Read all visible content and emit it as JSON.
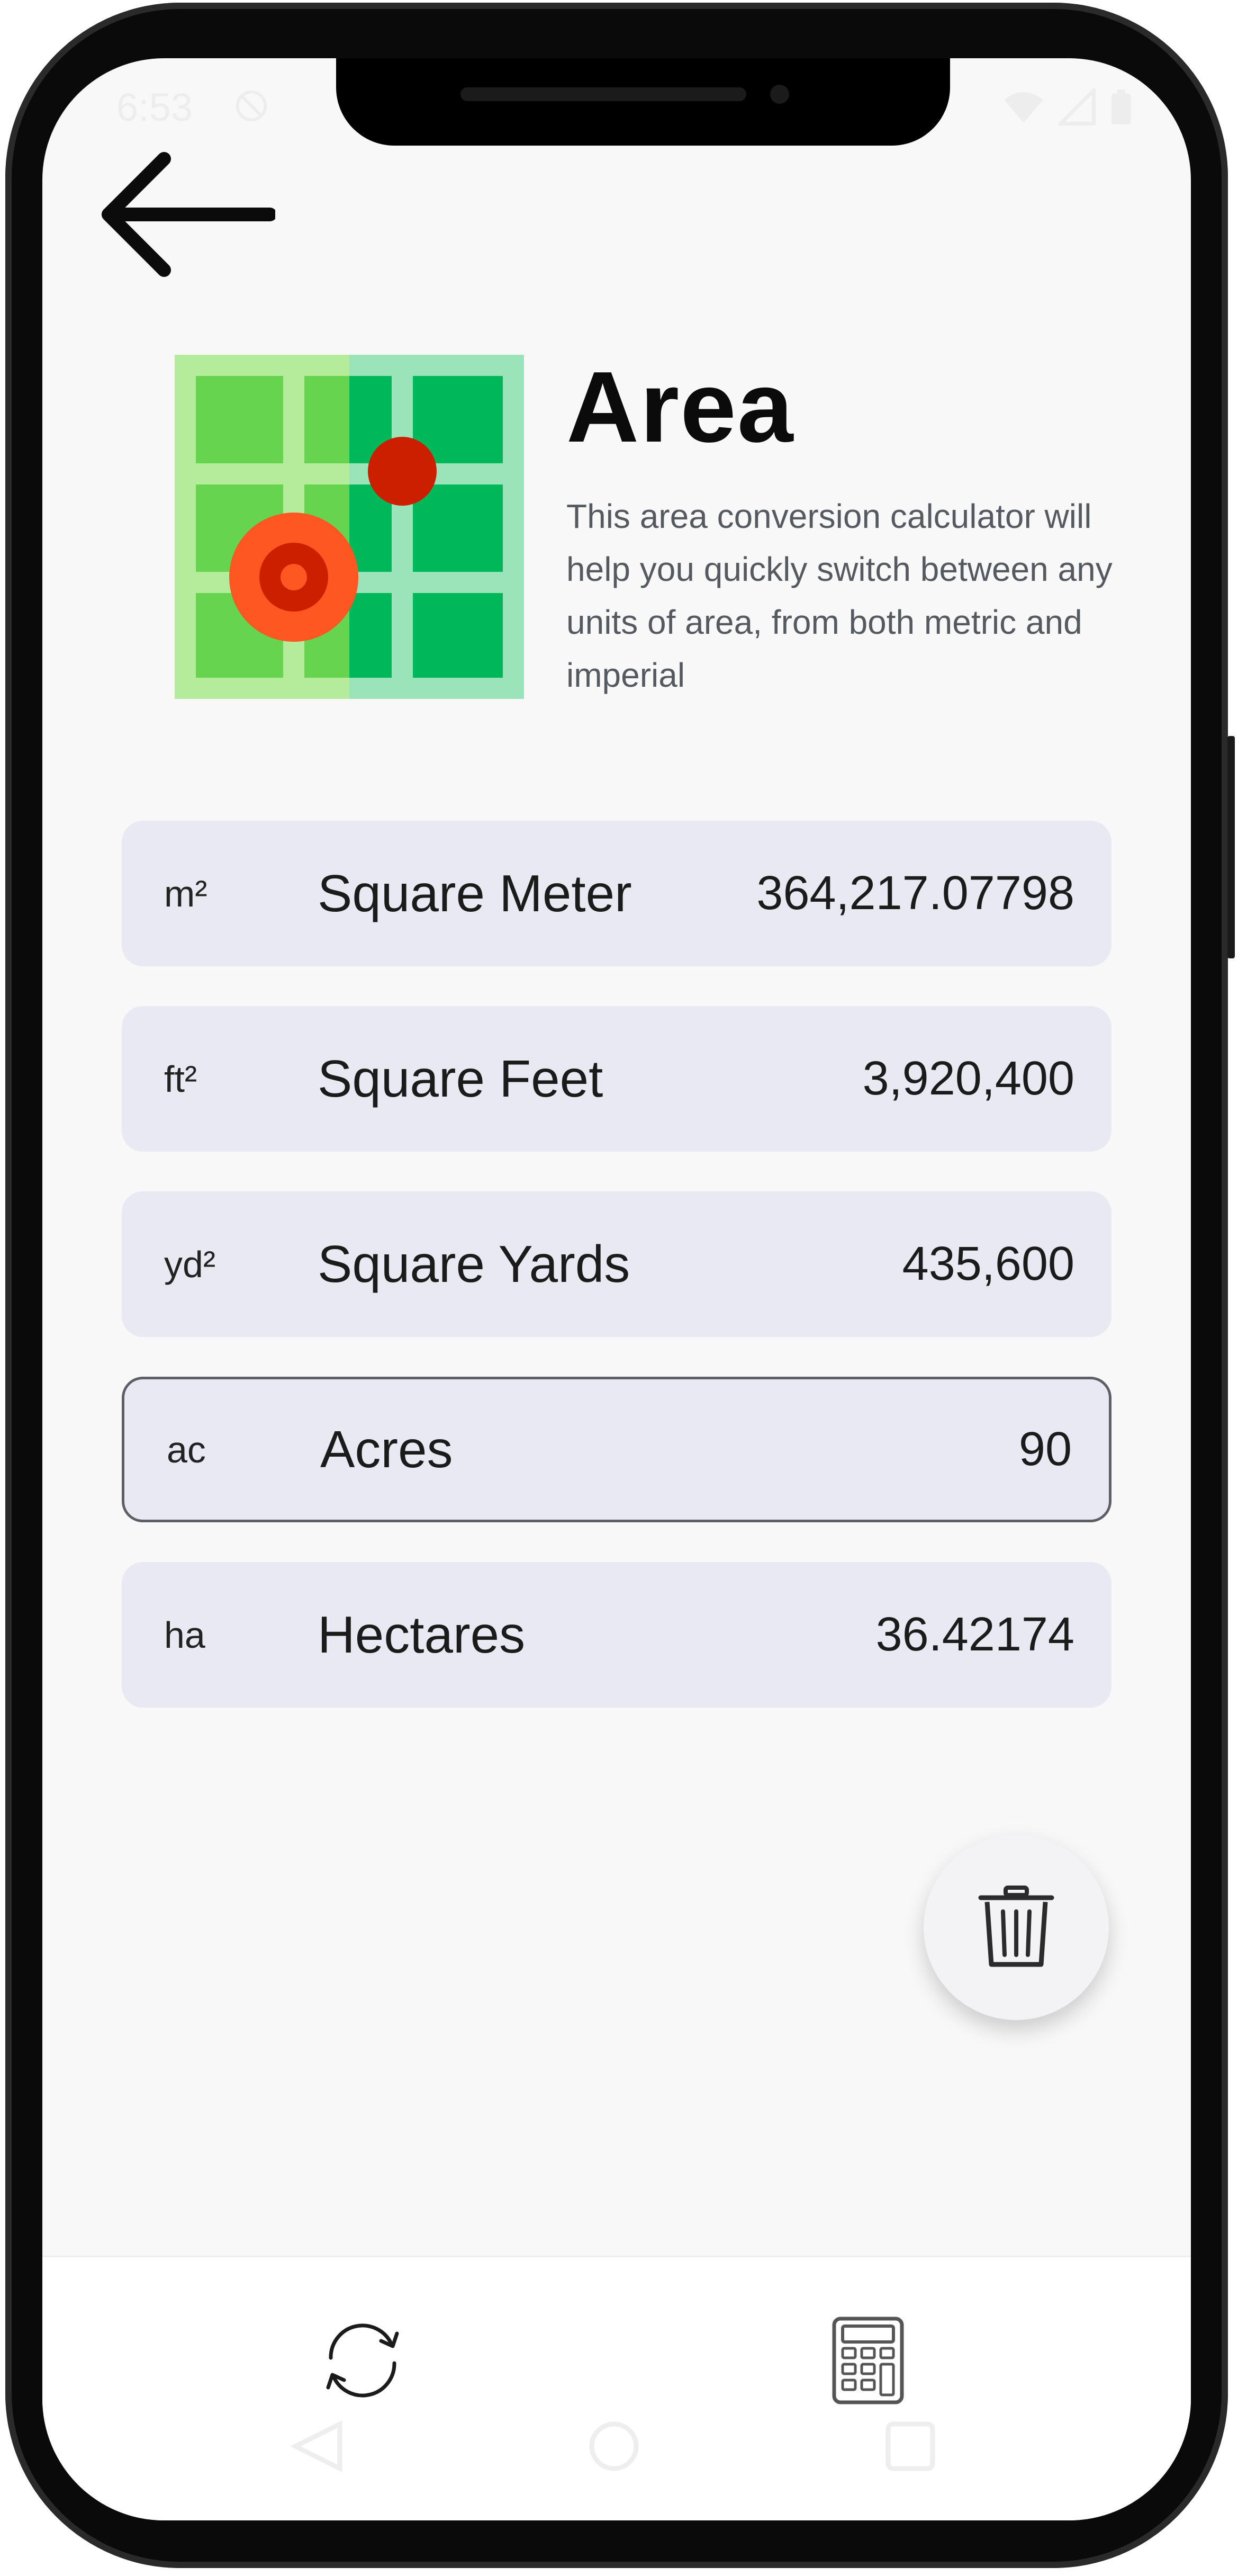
{
  "status_bar": {
    "time": "6:53",
    "icons": [
      "do-not-disturb-icon",
      "wifi-icon",
      "signal-icon",
      "battery-icon"
    ]
  },
  "header": {
    "back_icon": "arrow-left-icon"
  },
  "hero": {
    "icon": "area-map-icon",
    "title": "Area",
    "description": "This area conversion calculator will help you quickly switch between any units of area, from both metric and imperial"
  },
  "units": [
    {
      "abbr": "m²",
      "name": "Square Meter",
      "value": "364,217.07798",
      "active": false
    },
    {
      "abbr": "ft²",
      "name": "Square Feet",
      "value": "3,920,400",
      "active": false
    },
    {
      "abbr": "yd²",
      "name": "Square Yards",
      "value": "435,600",
      "active": false
    },
    {
      "abbr": "ac",
      "name": "Acres",
      "value": "90",
      "active": true
    },
    {
      "abbr": "ha",
      "name": "Hectares",
      "value": "36.42174",
      "active": false
    }
  ],
  "fab": {
    "icon": "trash-icon"
  },
  "bottom_nav": {
    "left_icon": "refresh-icon",
    "right_icon": "calculator-icon"
  },
  "system_nav": [
    "back-triangle-icon",
    "home-circle-icon",
    "recents-square-icon"
  ],
  "colors": {
    "background": "#f8f8f8",
    "row": "#e8e9f2",
    "active_border": "#5e5e66",
    "map_green": "#66d44f",
    "map_dark_green": "#00b85a",
    "pin_orange": "#ff5722",
    "pin_red": "#cc1f00"
  }
}
